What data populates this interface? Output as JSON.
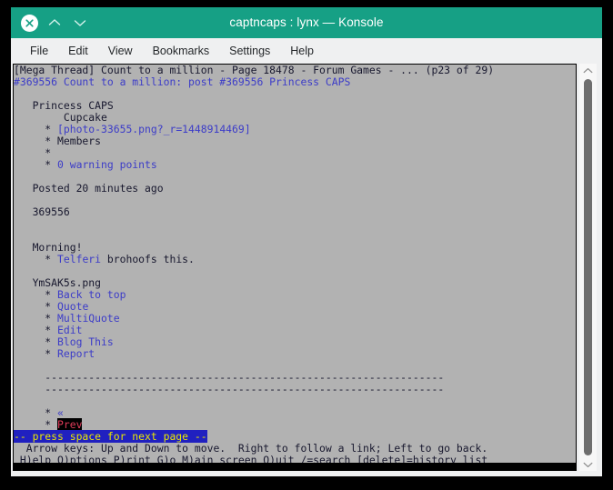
{
  "window": {
    "title": "captncaps : lynx — Konsole",
    "titlebar_color": "#16a085",
    "buttons": [
      {
        "name": "close",
        "glyph": "close-icon"
      },
      {
        "name": "shade-up",
        "glyph": "chevron-up-icon"
      },
      {
        "name": "shade-down",
        "glyph": "chevron-down-icon"
      }
    ]
  },
  "menubar": {
    "items": [
      {
        "label": "File"
      },
      {
        "label": "Edit"
      },
      {
        "label": "View"
      },
      {
        "label": "Bookmarks"
      },
      {
        "label": "Settings"
      },
      {
        "label": "Help"
      }
    ]
  },
  "terminal": {
    "background_color": "#b2b2b2",
    "text_color": "#18182e",
    "link_color": "#3c3cc8",
    "selected_link_fg": "#e03c5a",
    "selected_link_bg": "#000000",
    "statusbar_bg": "#2020c0",
    "statusbar_fg": "#e8e800",
    "lines": [
      "[Mega Thread] Count to a million - Page 18478 - Forum Games - ... (p23 of 29)",
      "#369556 Count to a million: post #369556 Princess CAPS",
      "",
      "   Princess CAPS",
      "        Cupcake",
      "     * [photo-33655.png?_r=1448914469]",
      "     * Members",
      "     *",
      "     * 0 warning points",
      "",
      "   Posted 20 minutes ago",
      "",
      "   369556",
      "",
      "",
      "   Morning!",
      "     * Telferi brohoofs this.",
      "",
      "   YmSAK5s.png",
      "     * Back to top",
      "     * Quote",
      "     * MultiQuote",
      "     * Edit",
      "     * Blog This",
      "     * Report",
      "",
      "     ----------------------------------------------------------------",
      "     ----------------------------------------------------------------",
      "",
      "     * «",
      "     * Prev"
    ],
    "line_parts": [
      [
        {
          "t": "[Mega Thread] Count to a million - Page 18478 - Forum Games - ... (p23 of 29)",
          "c": "plain"
        }
      ],
      [
        {
          "t": "#369556 Count to a million: post #369556 Princess CAPS",
          "c": "lnk"
        }
      ],
      [
        {
          "t": "",
          "c": "plain"
        }
      ],
      [
        {
          "t": "   Princess CAPS",
          "c": "plain"
        }
      ],
      [
        {
          "t": "        Cupcake",
          "c": "plain"
        }
      ],
      [
        {
          "t": "     * ",
          "c": "plain"
        },
        {
          "t": "[photo-33655.png?_r=1448914469]",
          "c": "lnk"
        }
      ],
      [
        {
          "t": "     * Members",
          "c": "plain"
        }
      ],
      [
        {
          "t": "     *",
          "c": "plain"
        }
      ],
      [
        {
          "t": "     * ",
          "c": "plain"
        },
        {
          "t": "0 warning points",
          "c": "lnk"
        }
      ],
      [
        {
          "t": "",
          "c": "plain"
        }
      ],
      [
        {
          "t": "   Posted 20 minutes ago",
          "c": "plain"
        }
      ],
      [
        {
          "t": "",
          "c": "plain"
        }
      ],
      [
        {
          "t": "   369556",
          "c": "plain"
        }
      ],
      [
        {
          "t": "",
          "c": "plain"
        }
      ],
      [
        {
          "t": "",
          "c": "plain"
        }
      ],
      [
        {
          "t": "   Morning!",
          "c": "plain"
        }
      ],
      [
        {
          "t": "     * ",
          "c": "plain"
        },
        {
          "t": "Telferi",
          "c": "lnk"
        },
        {
          "t": " brohoofs this.",
          "c": "plain"
        }
      ],
      [
        {
          "t": "",
          "c": "plain"
        }
      ],
      [
        {
          "t": "   YmSAK5s.png",
          "c": "plain"
        }
      ],
      [
        {
          "t": "     * ",
          "c": "plain"
        },
        {
          "t": "Back to top",
          "c": "lnk"
        }
      ],
      [
        {
          "t": "     * ",
          "c": "plain"
        },
        {
          "t": "Quote",
          "c": "lnk"
        }
      ],
      [
        {
          "t": "     * ",
          "c": "plain"
        },
        {
          "t": "MultiQuote",
          "c": "lnk"
        }
      ],
      [
        {
          "t": "     * ",
          "c": "plain"
        },
        {
          "t": "Edit",
          "c": "lnk"
        }
      ],
      [
        {
          "t": "     * ",
          "c": "plain"
        },
        {
          "t": "Blog This",
          "c": "lnk"
        }
      ],
      [
        {
          "t": "     * ",
          "c": "plain"
        },
        {
          "t": "Report",
          "c": "lnk"
        }
      ],
      [
        {
          "t": "",
          "c": "plain"
        }
      ],
      [
        {
          "t": "     ----------------------------------------------------------------",
          "c": "plain"
        }
      ],
      [
        {
          "t": "     ----------------------------------------------------------------",
          "c": "plain"
        }
      ],
      [
        {
          "t": "",
          "c": "plain"
        }
      ],
      [
        {
          "t": "     * ",
          "c": "plain"
        },
        {
          "t": "«",
          "c": "lnk"
        }
      ],
      [
        {
          "t": "     * ",
          "c": "plain"
        },
        {
          "t": "Prev",
          "c": "sel"
        }
      ]
    ],
    "status_line": "-- press space for next page --",
    "help_line_1": "  Arrow keys: Up and Down to move.  Right to follow a link; Left to go back.",
    "help_line_2": " H)elp O)ptions P)rint G)o M)ain screen Q)uit /=search [delete]=history list"
  },
  "scrollbar": {
    "up_arrow": "chevron-up-icon",
    "down_arrow": "chevron-down-icon",
    "thumb_color": "#6e6e6e"
  }
}
